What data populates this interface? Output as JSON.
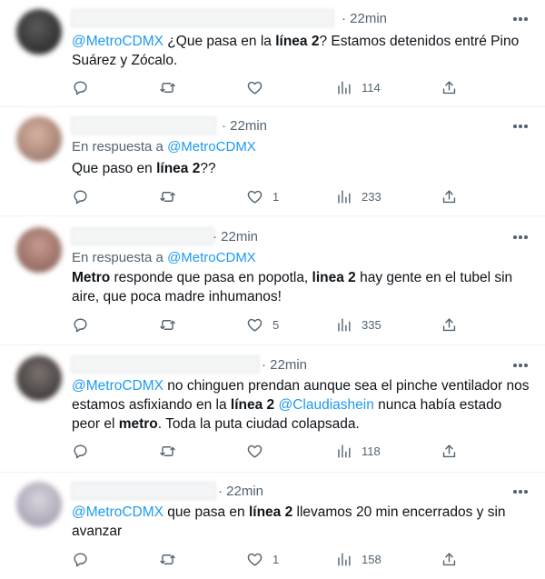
{
  "tweets": [
    {
      "time": "· 22min",
      "reply_to": null,
      "text": [
        {
          "t": "@MetroCDMX",
          "s": "mention"
        },
        {
          "t": " ¿Que pasa en la ",
          "s": ""
        },
        {
          "t": "línea 2",
          "s": "bold"
        },
        {
          "t": "? Estamos detenidos entré Pino Suárez y Zócalo.",
          "s": ""
        }
      ],
      "likes": "",
      "views": "114"
    },
    {
      "time": "· 22min",
      "reply_to": {
        "label": "En respuesta a ",
        "handle": "@MetroCDMX"
      },
      "text": [
        {
          "t": "Que paso en ",
          "s": ""
        },
        {
          "t": "línea 2",
          "s": "bold"
        },
        {
          "t": "??",
          "s": ""
        }
      ],
      "likes": "1",
      "views": "233"
    },
    {
      "time": "· 22min",
      "reply_to": {
        "label": "En respuesta a ",
        "handle": "@MetroCDMX"
      },
      "text": [
        {
          "t": "Metro",
          "s": "bold"
        },
        {
          "t": " responde que pasa en popotla, ",
          "s": ""
        },
        {
          "t": "linea 2",
          "s": "bold"
        },
        {
          "t": " hay gente en el tubel sin aire, que poca madre inhumanos!",
          "s": ""
        }
      ],
      "likes": "5",
      "views": "335"
    },
    {
      "time": "· 22min",
      "reply_to": null,
      "text": [
        {
          "t": "@MetroCDMX",
          "s": "mention"
        },
        {
          "t": " no chinguen prendan aunque sea el pinche ventilador nos estamos asfixiando en la ",
          "s": ""
        },
        {
          "t": "línea 2",
          "s": "bold"
        },
        {
          "t": " ",
          "s": ""
        },
        {
          "t": "@Claudiashein",
          "s": "mention"
        },
        {
          "t": " nunca había estado peor el ",
          "s": ""
        },
        {
          "t": "metro",
          "s": "bold"
        },
        {
          "t": ". Toda la puta ciudad colapsada.",
          "s": ""
        }
      ],
      "likes": "",
      "views": "118"
    },
    {
      "time": "· 22min",
      "reply_to": null,
      "text": [
        {
          "t": "@MetroCDMX",
          "s": "mention"
        },
        {
          "t": " que pasa en ",
          "s": ""
        },
        {
          "t": "línea 2",
          "s": "bold"
        },
        {
          "t": " llevamos 20 min encerrados y sin avanzar",
          "s": ""
        }
      ],
      "likes": "1",
      "views": "158"
    }
  ],
  "icons": {
    "reply": "reply-icon",
    "retweet": "retweet-icon",
    "like": "heart-icon",
    "views": "views-icon",
    "share": "share-icon",
    "more": "more-icon"
  },
  "colors": {
    "text": "#0f1419",
    "secondary": "#536471",
    "mention": "#1d9bf0",
    "divider": "#eff3f4"
  }
}
